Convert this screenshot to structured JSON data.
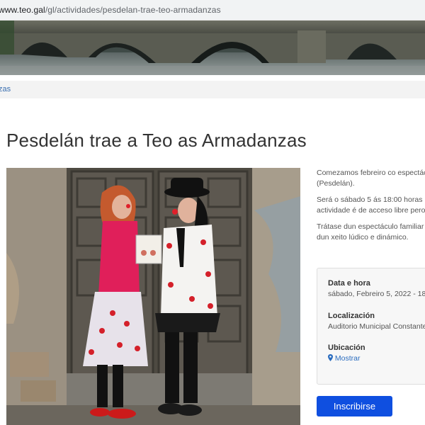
{
  "browser": {
    "url_domain": "www.teo.gal",
    "url_path": "/gl/actividades/pesdelan-trae-teo-armadanzas"
  },
  "breadcrumb": {
    "current": "zas"
  },
  "event": {
    "title": "Pesdelán trae a Teo as Armadanzas",
    "description": [
      "Comezamos febreiro co espectác",
      "(Pesdelán).",
      "Será o sábado 5 ás 18:00 horas n",
      "actividade é de acceso libre pero c",
      "Trátase dun espectáculo familiar",
      "dun xeito lúdico e dinámico."
    ],
    "info": {
      "datetime_label": "Data e hora",
      "datetime_value": "sábado, Febreiro 5, 2022 - 18:0",
      "location_label": "Localización",
      "location_value": "Auditorio Municipal Constante",
      "map_label": "Ubicación",
      "map_link": "Mostrar"
    },
    "signup_label": "Inscribirse"
  },
  "colors": {
    "accent": "#0f4fe0",
    "link": "#2a6cbf"
  },
  "icons": {
    "map": "map-marker-icon"
  }
}
